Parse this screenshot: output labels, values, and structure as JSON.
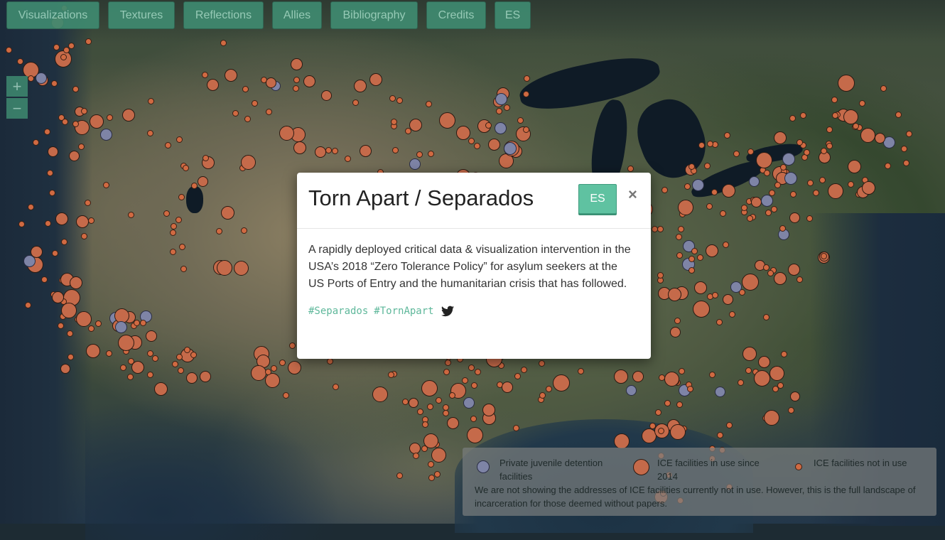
{
  "nav": {
    "items": [
      {
        "label": "Visualizations"
      },
      {
        "label": "Textures"
      },
      {
        "label": "Reflections"
      },
      {
        "label": "Allies"
      },
      {
        "label": "Bibliography"
      },
      {
        "label": "Credits"
      },
      {
        "label": "ES"
      }
    ]
  },
  "zoom": {
    "in_label": "+",
    "out_label": "−"
  },
  "modal": {
    "title": "Torn Apart / Separados",
    "language_button": "ES",
    "close_label": "×",
    "description": "A rapidly deployed critical data & visualization intervention in the USA’s 2018 “Zero Tolerance Policy” for asylum seekers at the US Ports of Entry and the humanitarian crisis that has followed.",
    "hashtags": [
      "#Separados",
      "#TornApart"
    ],
    "share_icon": "twitter-icon"
  },
  "legend": {
    "items": [
      {
        "label": "Private juvenile detention facilities",
        "color": "#7e84a6"
      },
      {
        "label": "ICE facilities in use since 2014",
        "color": "#c56a4a"
      },
      {
        "label": "ICE facilities not in use",
        "color": "#d06a42"
      }
    ],
    "note": "We are not showing the addresses of ICE facilities currently not in use. However, this is the full landscape of incarceration for those deemed without papers."
  },
  "colors": {
    "accent": "#3f8a70",
    "es_button": "#5fc2a1",
    "hashtag": "#5fb89b"
  }
}
